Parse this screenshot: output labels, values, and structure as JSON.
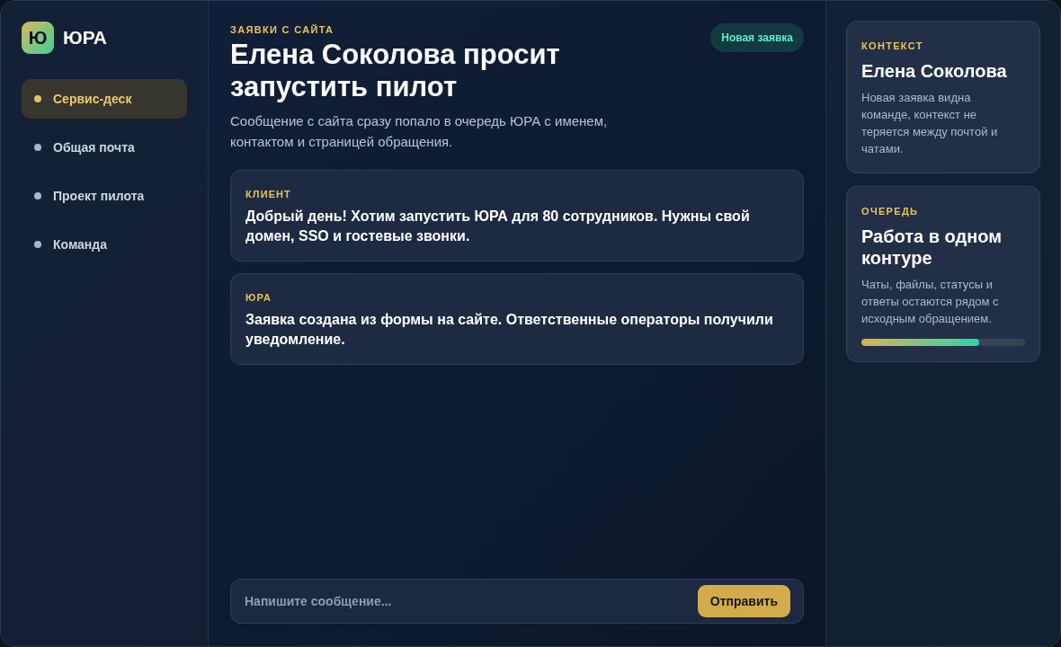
{
  "brand": {
    "logo_letter": "Ю",
    "name": "ЮРА"
  },
  "sidebar": {
    "items": [
      {
        "label": "Сервис-деск",
        "selected": true
      },
      {
        "label": "Общая почта",
        "selected": false
      },
      {
        "label": "Проект пилота",
        "selected": false
      },
      {
        "label": "Команда",
        "selected": false
      }
    ]
  },
  "header": {
    "eyebrow": "ЗАЯВКИ С САЙТА",
    "title": "Елена Соколова просит запустить пилот",
    "subtitle": "Сообщение с сайта сразу попало в очередь ЮРА с именем, контактом и страницей обращения.",
    "badge": "Новая заявка"
  },
  "messages": [
    {
      "author": "КЛИЕНТ",
      "text": "Добрый день! Хотим запустить ЮРА для 80 сотрудников. Нужны свой домен, SSO и гостевые звонки."
    },
    {
      "author": "ЮРА",
      "text": "Заявка создана из формы на сайте. Ответственные операторы получили уведомление."
    }
  ],
  "composer": {
    "placeholder": "Напишите сообщение...",
    "send_button": "Отправить"
  },
  "context_cards": [
    {
      "label": "КОНТЕКСТ",
      "title": "Елена Соколова",
      "text": "Новая заявка видна команде, контекст не теряется между почтой и чатами."
    },
    {
      "label": "ОЧЕРЕДЬ",
      "title": "Работа в одном контуре",
      "text": "Чаты, файлы, статусы и ответы остаются рядом с исходным обращением.",
      "level": 0.72
    }
  ]
}
